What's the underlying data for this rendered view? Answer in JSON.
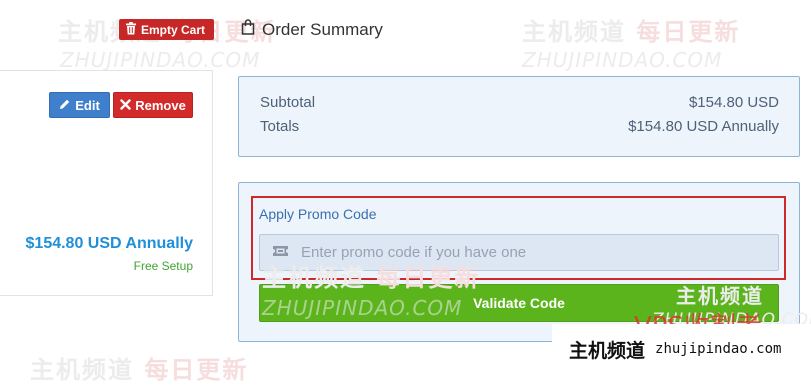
{
  "header": {
    "empty_cart_label": "Empty Cart",
    "empty_cart_icon": "trash-icon",
    "order_summary_label": "Order Summary",
    "order_summary_icon": "shopping-bag-icon"
  },
  "cart_item": {
    "edit_label": "Edit",
    "edit_icon": "pencil-icon",
    "remove_label": "Remove",
    "remove_icon": "close-icon",
    "price": "$154.80 USD Annually",
    "setup_note": "Free Setup"
  },
  "summary": {
    "subtotal_label": "Subtotal",
    "subtotal_value": "$154.80 USD",
    "totals_label": "Totals",
    "totals_value": "$154.80 USD Annually"
  },
  "promo": {
    "title": "Apply Promo Code",
    "placeholder": "Enter promo code if you have one",
    "input_icon": "ticket-icon",
    "validate_label": "Validate Code"
  },
  "watermark": {
    "cn_text": "主机频道",
    "cn_red_text": "每日更新",
    "en_text": "ZHUJIPINDAO.COM",
    "badge_cn": "主机频道",
    "badge_url": "zhujipindao.com",
    "stamp_text": "VPS收割者"
  },
  "colors": {
    "accent_blue": "#3f7fcb",
    "danger_red": "#d32a2a",
    "success_green": "#5cb41d",
    "price_blue": "#1f8fd8",
    "free_green": "#3fa631",
    "panel_bg": "#eef4fb",
    "panel_border": "#8fb4d9",
    "highlight_red": "#cf2a2a"
  }
}
